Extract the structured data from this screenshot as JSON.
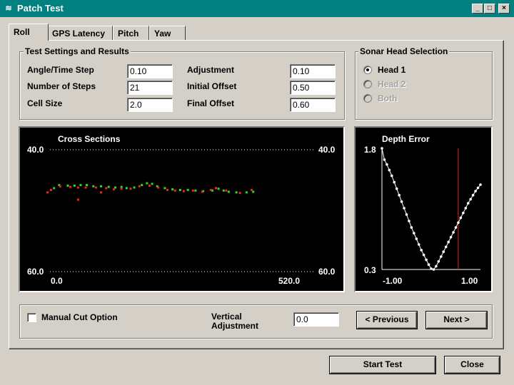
{
  "window": {
    "title": "Patch Test"
  },
  "tabs": [
    {
      "label": "Roll",
      "active": true
    },
    {
      "label": "GPS Latency",
      "active": false
    },
    {
      "label": "Pitch",
      "active": false
    },
    {
      "label": "Yaw",
      "active": false
    }
  ],
  "test_settings": {
    "group_label": "Test Settings and Results",
    "angle_time_step": {
      "label": "Angle/Time Step",
      "value": "0.10"
    },
    "number_of_steps": {
      "label": "Number of Steps",
      "value": "21"
    },
    "cell_size": {
      "label": "Cell Size",
      "value": "2.0"
    },
    "adjustment": {
      "label": "Adjustment",
      "value": "0.10"
    },
    "initial_offset": {
      "label": "Initial Offset",
      "value": "0.50"
    },
    "final_offset": {
      "label": "Final Offset",
      "value": "0.60"
    }
  },
  "sonar_head": {
    "group_label": "Sonar Head Selection",
    "options": [
      {
        "label": "Head 1",
        "selected": true,
        "enabled": true
      },
      {
        "label": "Head 2",
        "selected": false,
        "enabled": false
      },
      {
        "label": "Both",
        "selected": false,
        "enabled": false
      }
    ]
  },
  "cross_sections": {
    "title": "Cross Sections",
    "y_top_label": "40.0",
    "y_bottom_label": "60.0",
    "x_left_label": "0.0",
    "x_right_label": "520.0"
  },
  "depth_error": {
    "title": "Depth Error",
    "y_top_label": "1.8",
    "y_bottom_label": "0.3",
    "x_left_label": "-1.00",
    "x_right_label": "1.00"
  },
  "chart_data": [
    {
      "type": "scatter",
      "title": "Cross Sections",
      "xlim": [
        0.0,
        520.0
      ],
      "ylim": [
        40.0,
        60.0
      ],
      "y_inverted": true,
      "colors": {
        "series_a": "#22dd22",
        "series_b": "#ee2222"
      },
      "series": [
        {
          "values": [
            [
              8,
              46.3
            ],
            [
              18,
              45.8
            ],
            [
              35,
              45.9
            ],
            [
              48,
              45.9
            ],
            [
              60,
              45.8
            ],
            [
              72,
              45.8
            ],
            [
              85,
              46.0
            ],
            [
              100,
              46.0
            ],
            [
              115,
              46.1
            ],
            [
              128,
              46.2
            ],
            [
              140,
              46.1
            ],
            [
              150,
              46.3
            ],
            [
              165,
              46.2
            ],
            [
              180,
              45.8
            ],
            [
              190,
              45.5
            ],
            [
              200,
              45.6
            ],
            [
              210,
              46.0
            ],
            [
              225,
              46.3
            ],
            [
              240,
              46.5
            ],
            [
              255,
              46.6
            ],
            [
              270,
              46.6
            ],
            [
              285,
              46.7
            ],
            [
              300,
              46.8
            ],
            [
              318,
              46.7
            ],
            [
              330,
              46.4
            ],
            [
              340,
              46.7
            ],
            [
              350,
              46.9
            ],
            [
              365,
              47.0
            ],
            [
              385,
              47.0
            ],
            [
              398,
              46.9
            ]
          ]
        },
        {
          "values": [
            [
              -5,
              47.0
            ],
            [
              2,
              46.6
            ],
            [
              20,
              46.0
            ],
            [
              40,
              46.1
            ],
            [
              55,
              46.2
            ],
            [
              70,
              46.2
            ],
            [
              90,
              46.2
            ],
            [
              110,
              46.3
            ],
            [
              125,
              46.5
            ],
            [
              140,
              46.4
            ],
            [
              158,
              46.4
            ],
            [
              175,
              46.0
            ],
            [
              195,
              45.9
            ],
            [
              212,
              46.2
            ],
            [
              230,
              46.6
            ],
            [
              245,
              46.7
            ],
            [
              262,
              46.8
            ],
            [
              280,
              46.7
            ],
            [
              298,
              46.9
            ],
            [
              315,
              46.6
            ],
            [
              325,
              46.3
            ],
            [
              345,
              46.7
            ],
            [
              372,
              47.1
            ],
            [
              395,
              46.6
            ],
            [
              55,
              48.2
            ],
            [
              100,
              47.0
            ]
          ]
        }
      ]
    },
    {
      "type": "line",
      "title": "Depth Error",
      "xlim": [
        -1.0,
        1.0
      ],
      "ylim": [
        0.3,
        1.8
      ],
      "colors": {
        "line": "#ffffff",
        "marker_line": "#dd2222"
      },
      "marker_x": 0.55,
      "x": [
        -1.0,
        -0.95,
        -0.9,
        -0.85,
        -0.8,
        -0.75,
        -0.7,
        -0.65,
        -0.6,
        -0.55,
        -0.5,
        -0.45,
        -0.4,
        -0.35,
        -0.3,
        -0.25,
        -0.2,
        -0.15,
        -0.1,
        -0.05,
        0.0,
        0.05,
        0.1,
        0.15,
        0.2,
        0.25,
        0.3,
        0.35,
        0.4,
        0.45,
        0.5,
        0.55,
        0.6,
        0.65,
        0.7,
        0.75,
        0.8,
        0.85,
        0.9,
        0.95,
        1.0
      ],
      "y": [
        1.8,
        1.66,
        1.6,
        1.53,
        1.46,
        1.38,
        1.3,
        1.22,
        1.14,
        1.06,
        0.98,
        0.9,
        0.82,
        0.75,
        0.68,
        0.61,
        0.54,
        0.48,
        0.42,
        0.36,
        0.31,
        0.3,
        0.34,
        0.4,
        0.46,
        0.52,
        0.58,
        0.64,
        0.7,
        0.76,
        0.82,
        0.88,
        0.94,
        1.0,
        1.06,
        1.12,
        1.17,
        1.22,
        1.27,
        1.31,
        1.35
      ]
    }
  ],
  "manual_cut": {
    "label": "Manual Cut Option",
    "checked": false
  },
  "vertical_adjustment": {
    "label_line1": "Vertical",
    "label_line2": "Adjustment",
    "value": "0.0"
  },
  "nav_buttons": {
    "previous": "< Previous",
    "next": "Next >"
  },
  "footer_buttons": {
    "start_test": "Start Test",
    "close": "Close"
  }
}
